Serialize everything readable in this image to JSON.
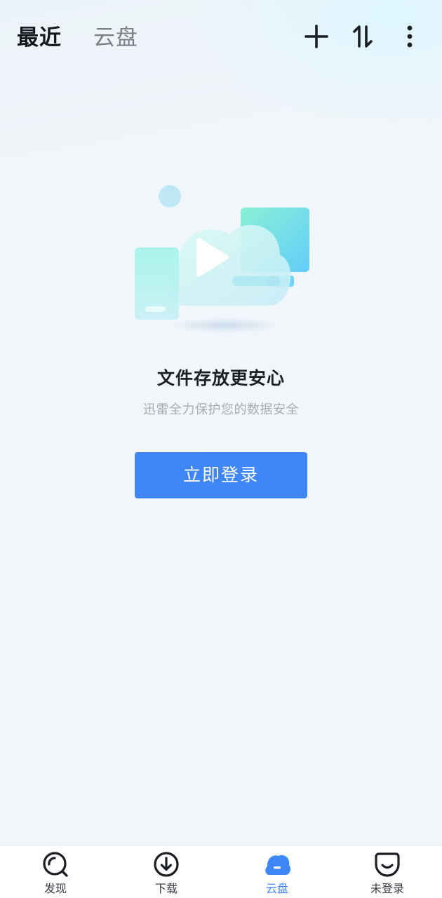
{
  "header": {
    "tabs": [
      {
        "label": "最近",
        "active": true
      },
      {
        "label": "云盘",
        "active": false
      }
    ],
    "actions": [
      "add-icon",
      "sort-icon",
      "more-icon"
    ]
  },
  "empty_state": {
    "illustration": "cloud-play-devices-illustration",
    "title": "文件存放更安心",
    "subtitle": "迅雷全力保护您的数据安全",
    "login_label": "立即登录"
  },
  "bottom_nav": {
    "items": [
      {
        "label": "发现",
        "icon": "discover-icon",
        "active": false
      },
      {
        "label": "下载",
        "icon": "download-icon",
        "active": false
      },
      {
        "label": "云盘",
        "icon": "cloud-icon",
        "active": true
      },
      {
        "label": "未登录",
        "icon": "profile-icon",
        "active": false
      }
    ]
  },
  "colors": {
    "accent": "#3f86f7",
    "text_primary": "#15181d",
    "text_secondary": "#7d8187",
    "text_muted": "#a8adb3"
  }
}
